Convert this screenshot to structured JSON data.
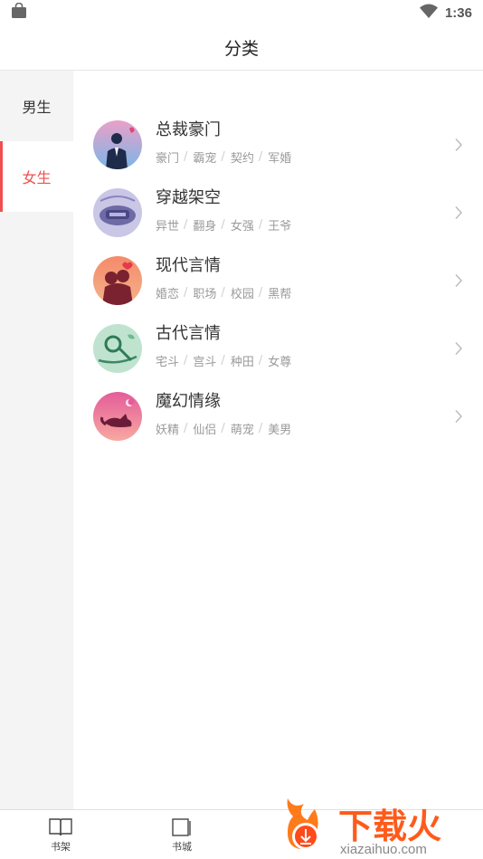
{
  "status_bar": {
    "time": "1:36"
  },
  "header": {
    "title": "分类"
  },
  "sidebar": {
    "items": [
      {
        "label": "男生",
        "active": false
      },
      {
        "label": "女生",
        "active": true
      }
    ]
  },
  "categories": [
    {
      "name": "总裁豪门",
      "tags": [
        "豪门",
        "霸宠",
        "契约",
        "军婚"
      ],
      "icon": "ceo-icon"
    },
    {
      "name": "穿越架空",
      "tags": [
        "异世",
        "翻身",
        "女强",
        "王爷"
      ],
      "icon": "time-travel-icon"
    },
    {
      "name": "现代言情",
      "tags": [
        "婚恋",
        "职场",
        "校园",
        "黑帮"
      ],
      "icon": "modern-romance-icon"
    },
    {
      "name": "古代言情",
      "tags": [
        "宅斗",
        "宫斗",
        "种田",
        "女尊"
      ],
      "icon": "ancient-romance-icon"
    },
    {
      "name": "魔幻情缘",
      "tags": [
        "妖精",
        "仙侣",
        "萌宠",
        "美男"
      ],
      "icon": "fantasy-romance-icon"
    }
  ],
  "bottom_nav": {
    "items": [
      {
        "label": "书架",
        "icon": "bookshelf-icon"
      },
      {
        "label": "书城",
        "icon": "bookstore-icon"
      }
    ]
  },
  "watermark": {
    "text": "下载火",
    "url_text": "xiazaihuo.com"
  },
  "colors": {
    "accent": "#f04e4e",
    "sidebar_bg": "#f4f4f4",
    "tag_text": "#9a9a9a"
  }
}
